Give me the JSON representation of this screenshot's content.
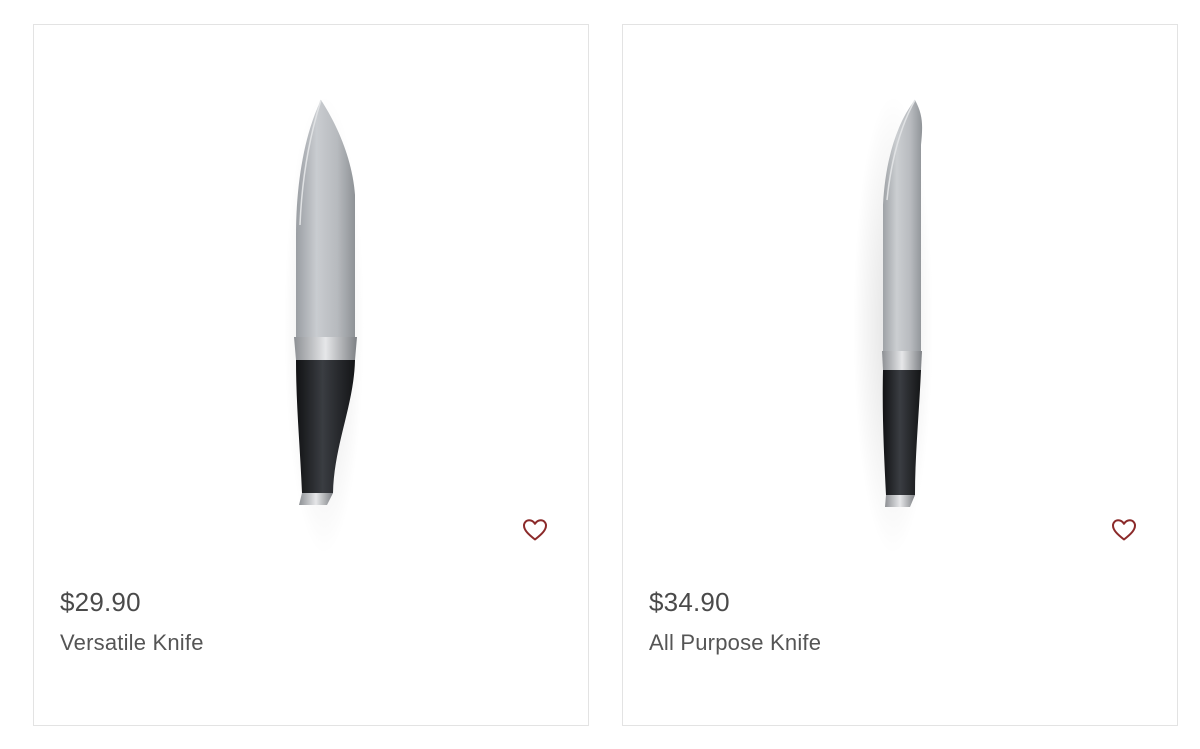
{
  "products": [
    {
      "price": "$29.90",
      "name": "Versatile Knife",
      "image_icon": "chef-knife-image",
      "favorite_icon": "heart-outline-icon"
    },
    {
      "price": "$34.90",
      "name": "All Purpose Knife",
      "image_icon": "chef-knife-image",
      "favorite_icon": "heart-outline-icon"
    }
  ],
  "colors": {
    "heart": "#8b2a2a",
    "card_border": "#e3e3e3",
    "price_text": "#4a4a4a",
    "name_text": "#555555"
  }
}
